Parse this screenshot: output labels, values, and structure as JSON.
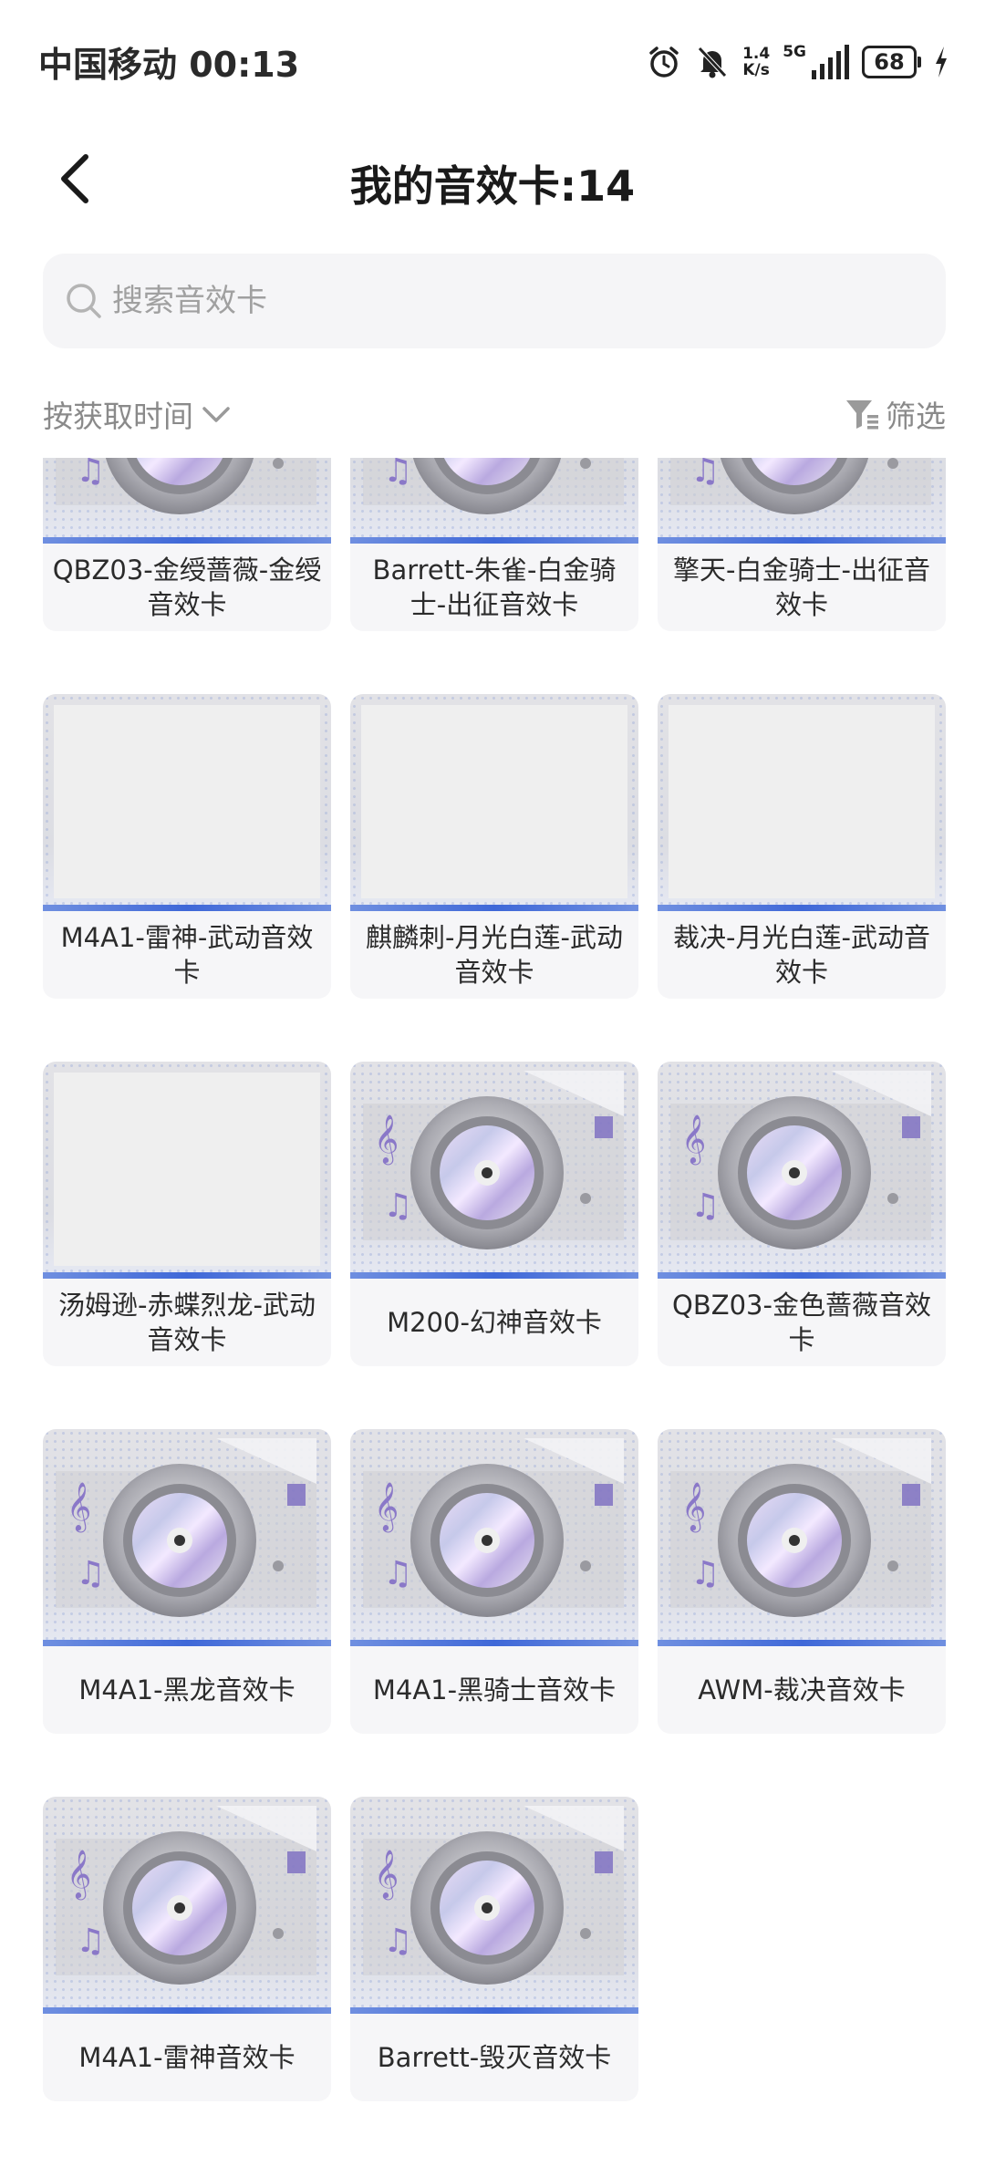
{
  "status_bar": {
    "carrier_time": "中国移动 00:13",
    "net_speed_top": "1.4",
    "net_speed_bottom": "K/s",
    "network": "5G",
    "battery": "68",
    "icons": [
      "alarm-icon",
      "bell-off-icon",
      "signal-icon",
      "battery-icon",
      "charging-icon"
    ]
  },
  "header": {
    "back_icon": "chevron-left-icon",
    "title": "我的音效卡:14"
  },
  "search": {
    "icon": "search-icon",
    "placeholder": "搜索音效卡",
    "value": ""
  },
  "sort": {
    "label": "按获取时间",
    "icon": "chevron-down-icon"
  },
  "filter": {
    "label": "筛选",
    "icon": "filter-icon"
  },
  "colors": {
    "accent_blue": "#3f68d8",
    "card_bg": "#f6f6f8",
    "muted_text": "#8a8a8a"
  },
  "cards": [
    {
      "label": "QBZ03-金绶蔷薇-金绶音效卡",
      "image": "disc"
    },
    {
      "label": "Barrett-朱雀-白金骑士-出征音效卡",
      "image": "disc"
    },
    {
      "label": "擎天-白金骑士-出征音效卡",
      "image": "disc"
    },
    {
      "label": "M4A1-雷神-武动音效卡",
      "image": "blank"
    },
    {
      "label": "麒麟刺-月光白莲-武动音效卡",
      "image": "blank"
    },
    {
      "label": "裁决-月光白莲-武动音效卡",
      "image": "blank"
    },
    {
      "label": "汤姆逊-赤蝶烈龙-武动音效卡",
      "image": "blank"
    },
    {
      "label": "M200-幻神音效卡",
      "image": "disc"
    },
    {
      "label": "QBZ03-金色蔷薇音效卡",
      "image": "disc"
    },
    {
      "label": "M4A1-黑龙音效卡",
      "image": "disc"
    },
    {
      "label": "M4A1-黑骑士音效卡",
      "image": "disc"
    },
    {
      "label": "AWM-裁决音效卡",
      "image": "disc"
    },
    {
      "label": "M4A1-雷神音效卡",
      "image": "disc"
    },
    {
      "label": "Barrett-毁灭音效卡",
      "image": "disc"
    }
  ]
}
